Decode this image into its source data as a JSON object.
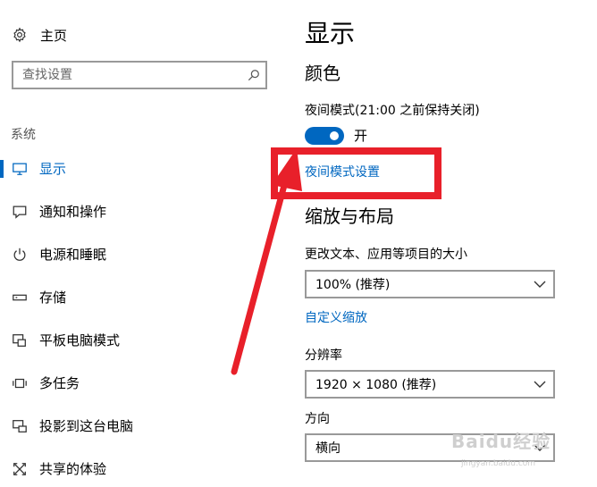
{
  "sidebar": {
    "home_label": "主页",
    "search_placeholder": "查找设置",
    "section_label": "系统",
    "items": [
      {
        "label": "显示",
        "icon": "monitor-icon",
        "active": true
      },
      {
        "label": "通知和操作",
        "icon": "message-icon"
      },
      {
        "label": "电源和睡眠",
        "icon": "power-icon"
      },
      {
        "label": "存储",
        "icon": "drive-icon"
      },
      {
        "label": "平板电脑模式",
        "icon": "tablet-mode-icon"
      },
      {
        "label": "多任务",
        "icon": "multitask-icon"
      },
      {
        "label": "投影到这台电脑",
        "icon": "project-icon"
      },
      {
        "label": "共享的体验",
        "icon": "shared-experiences-icon"
      }
    ]
  },
  "main": {
    "title": "显示",
    "color_heading": "颜色",
    "night_light_label": "夜间模式(21:00 之前保持关闭)",
    "night_light_toggle": "开",
    "night_light_settings_link": "夜间模式设置",
    "scale_heading": "缩放与布局",
    "scale_label": "更改文本、应用等项目的大小",
    "scale_value": "100% (推荐)",
    "custom_scale_link": "自定义缩放",
    "resolution_label": "分辨率",
    "resolution_value": "1920 × 1080 (推荐)",
    "orientation_label": "方向",
    "orientation_value": "横向"
  },
  "watermark": {
    "text": "Baidu经验",
    "url_text": "jingyan.baidu.com"
  },
  "colors": {
    "accent": "#0067c0",
    "annotation": "#e8202a"
  }
}
